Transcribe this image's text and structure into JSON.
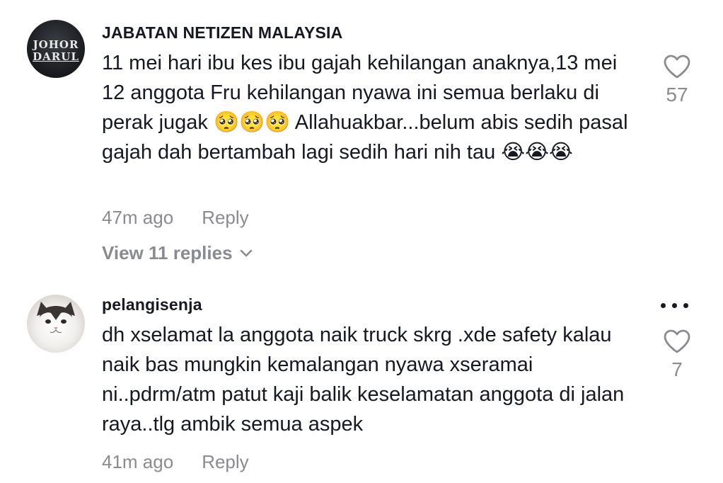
{
  "comments": [
    {
      "username": "JABATAN NETIZEN MALAYSIA",
      "avatar_text": [
        "JOHOR",
        "DARUL"
      ],
      "text": "11 mei hari ibu kes ibu gajah kehilangan anaknya,13 mei 12 anggota Fru kehilangan nyawa ini semua berlaku di perak jugak 🥺🥺🥺 Allahuakbar...belum abis sedih pasal gajah dah bertambah lagi sedih hari nih tau 😭😭😭",
      "time": "47m ago",
      "reply_label": "Reply",
      "likes": "57",
      "view_replies": "View 11 replies"
    },
    {
      "username": "pelangisenja",
      "text": "dh xselamat la anggota naik truck skrg .xde safety kalau naik bas mungkin kemalangan nyawa xseramai ni..pdrm/atm patut kaji balik keselamatan anggota di jalan raya..tlg ambik semua aspek",
      "time": "41m ago",
      "reply_label": "Reply",
      "likes": "7"
    }
  ],
  "colors": {
    "text": "#161823",
    "muted": "#8a8b91",
    "background": "#ffffff"
  },
  "icons": {
    "like": "heart-outline-icon",
    "more": "more-dots-icon",
    "expand": "chevron-down-icon"
  }
}
